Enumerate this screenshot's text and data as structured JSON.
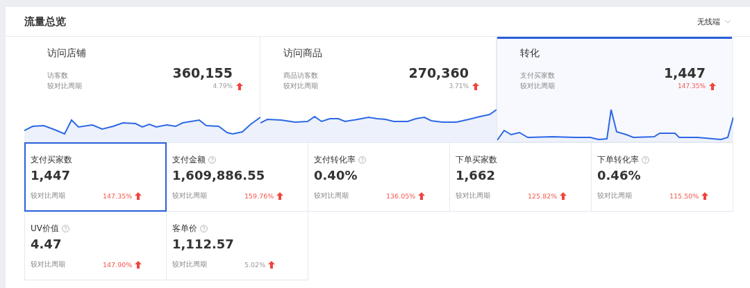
{
  "panel": {
    "title": "流量总览",
    "dropdown": "无线端"
  },
  "overview_tiles": [
    {
      "title": "访问店铺",
      "metric": "访客数",
      "value": "360,155",
      "compare_label": "较对比周期",
      "change": "4.79%",
      "color": "#999999",
      "selected": false
    },
    {
      "title": "访问商品",
      "metric": "商品访客数",
      "value": "270,360",
      "compare_label": "较对比周期",
      "change": "3.71%",
      "color": "#999999",
      "selected": false
    },
    {
      "title": "转化",
      "metric": "支付买家数",
      "value": "1,447",
      "compare_label": "较对比周期",
      "change": "147.35%",
      "color": "#f5574d",
      "selected": true
    }
  ],
  "metric_cells": [
    {
      "title": "支付买家数",
      "help": false,
      "value": "1,447",
      "compare_label": "较对比周期",
      "change": "147.35%",
      "color": "#f5574d",
      "selected": true
    },
    {
      "title": "支付金额",
      "help": true,
      "value": "1,609,886.55",
      "compare_label": "较对比周期",
      "change": "159.76%",
      "color": "#f5574d",
      "selected": false
    },
    {
      "title": "支付转化率",
      "help": true,
      "value": "0.40%",
      "compare_label": "较对比周期",
      "change": "136.05%",
      "color": "#f5574d",
      "selected": false
    },
    {
      "title": "下单买家数",
      "help": false,
      "value": "1,662",
      "compare_label": "较对比周期",
      "change": "125.82%",
      "color": "#f5574d",
      "selected": false
    },
    {
      "title": "下单转化率",
      "help": true,
      "value": "0.46%",
      "compare_label": "较对比周期",
      "change": "115.50%",
      "color": "#f5574d",
      "selected": false
    },
    {
      "title": "UV价值",
      "help": true,
      "value": "4.47",
      "compare_label": "较对比周期",
      "change": "147.90%",
      "color": "#f5574d",
      "selected": false
    },
    {
      "title": "客单价",
      "help": true,
      "value": "1,112.57",
      "compare_label": "较对比周期",
      "change": "5.02%",
      "color": "#999999",
      "selected": false
    }
  ]
}
